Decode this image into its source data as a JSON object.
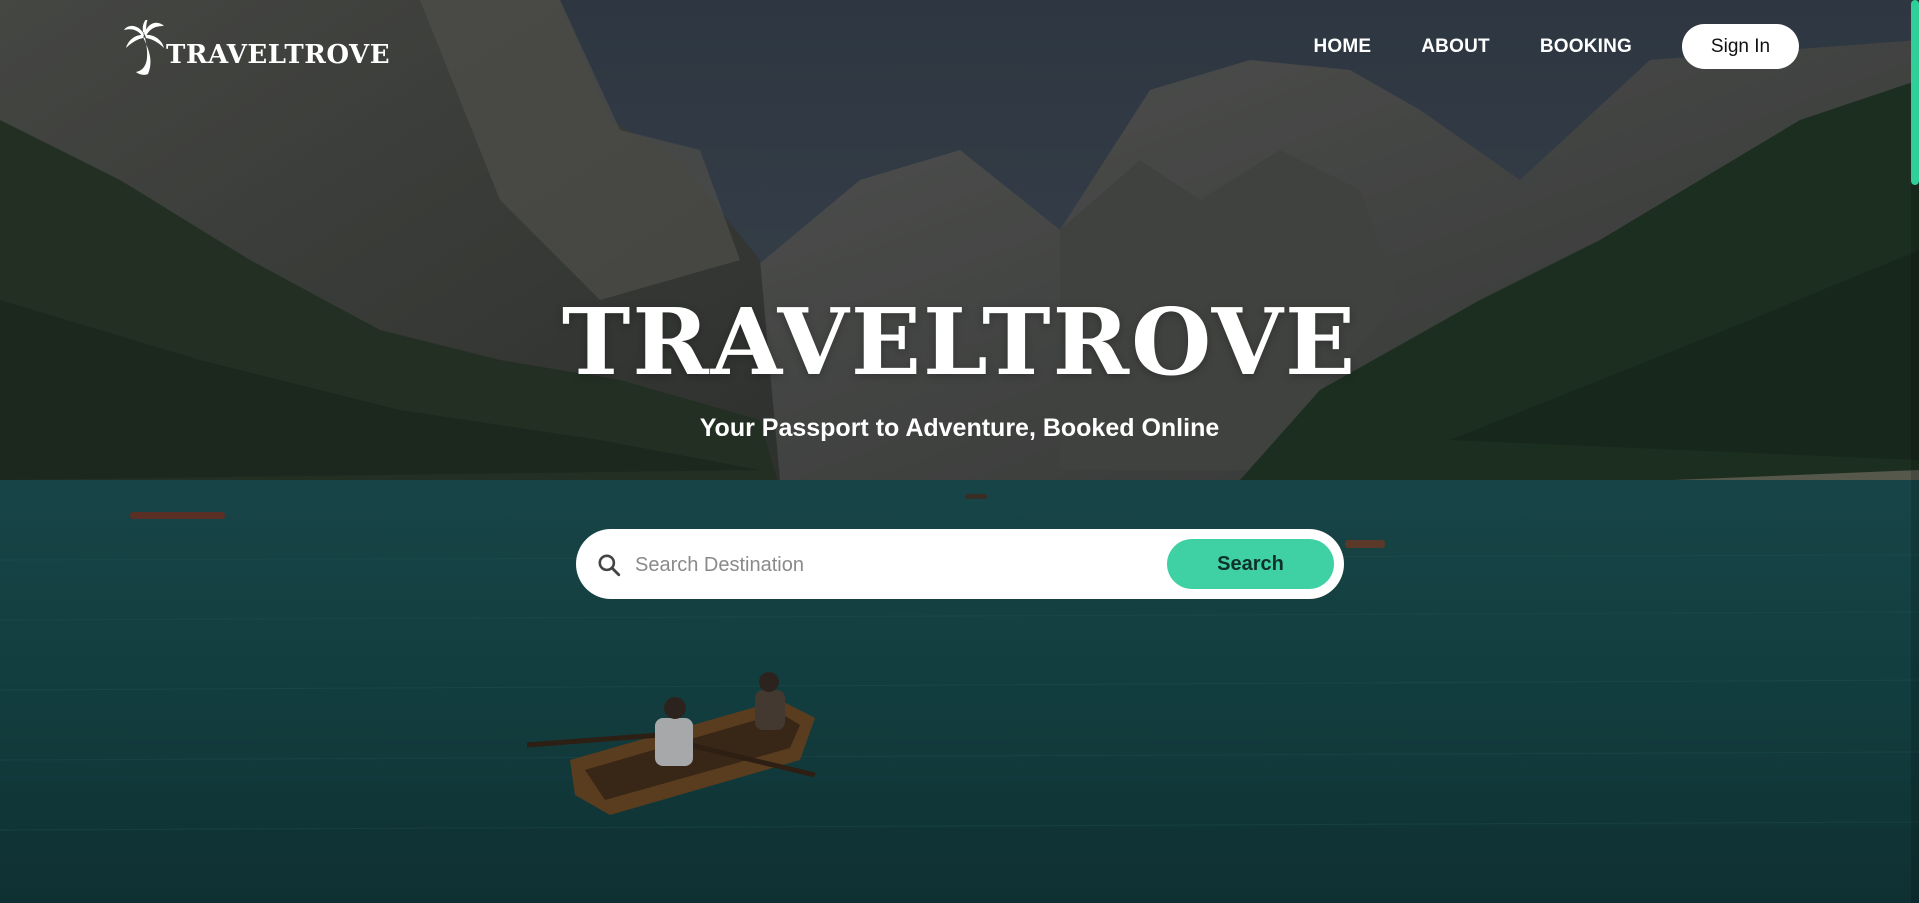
{
  "header": {
    "logo_text": "TRAVELTROVE",
    "logo_icon": "palm-tree-icon",
    "nav": [
      {
        "label": "HOME"
      },
      {
        "label": "ABOUT"
      },
      {
        "label": "BOOKING"
      }
    ],
    "signin_label": "Sign In"
  },
  "hero": {
    "title": "TRAVELTROVE",
    "subtitle": "Your Passport to Adventure, Booked Online"
  },
  "search": {
    "placeholder": "Search Destination",
    "value": "",
    "button_label": "Search",
    "icon": "search-icon"
  },
  "colors": {
    "accent": "#3fd1a3",
    "text": "#ffffff",
    "button_text": "#10312a"
  }
}
